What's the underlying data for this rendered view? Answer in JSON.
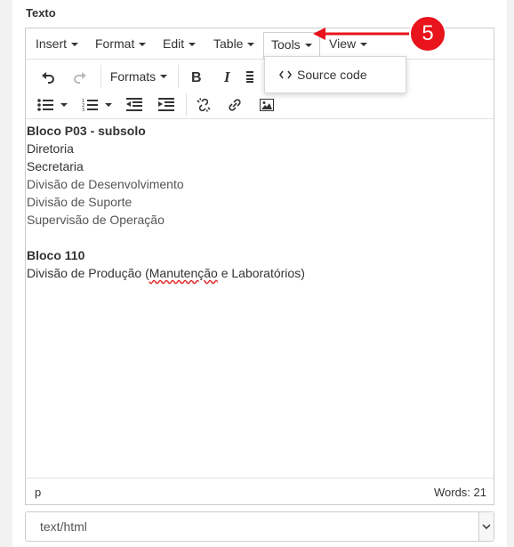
{
  "field_label": "Texto",
  "menubar": {
    "items": [
      {
        "label": "Insert"
      },
      {
        "label": "Format"
      },
      {
        "label": "Edit"
      },
      {
        "label": "Table"
      },
      {
        "label": "Tools"
      },
      {
        "label": "View"
      }
    ]
  },
  "toolbar": {
    "formats_label": "Formats",
    "buttons": [
      "undo-icon",
      "redo-icon",
      "bold-icon",
      "italic-icon",
      "align-icon",
      "bullet-list-icon",
      "numbered-list-icon",
      "outdent-icon",
      "indent-icon",
      "unlink-icon",
      "link-icon",
      "image-icon"
    ]
  },
  "tools_menu": {
    "source_code_label": "Source code",
    "source_code_icon": "code-icon"
  },
  "content": {
    "lines": [
      {
        "text": "Bloco P03 - subsolo",
        "bold": true
      },
      {
        "text": "Diretoria"
      },
      {
        "text": "Secretaria"
      },
      {
        "text": "Divisão de Desenvolvimento"
      },
      {
        "text": "Divisão de Suporte"
      },
      {
        "text": "Supervisão de Operação"
      },
      {
        "text": "Bloco 110",
        "bold": true
      },
      {
        "text_before": "Divisão de Produção (",
        "text_misspelled": "Manutenção",
        "text_after": " e Laboratórios)"
      }
    ]
  },
  "statusbar": {
    "path": "p",
    "word_count": "Words: 21"
  },
  "mode_select": {
    "value": "text/html"
  },
  "annotation": {
    "step_number": "5",
    "color": "#e8131b"
  }
}
